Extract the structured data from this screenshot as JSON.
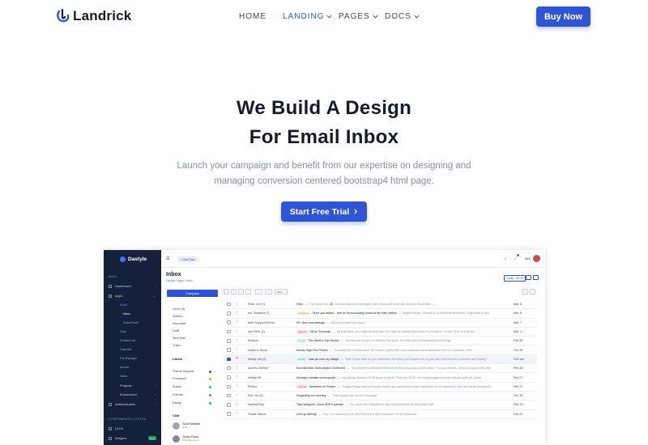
{
  "brand": {
    "name": "Landrick"
  },
  "nav": {
    "items": [
      {
        "label": "HOME",
        "active": false,
        "has_dropdown": false
      },
      {
        "label": "LANDING",
        "active": true,
        "has_dropdown": true
      },
      {
        "label": "PAGES",
        "active": false,
        "has_dropdown": true
      },
      {
        "label": "DOCS",
        "active": false,
        "has_dropdown": true
      }
    ],
    "buy_label": "Buy Now"
  },
  "hero": {
    "title_line1": "We Build A Design",
    "title_line2": "For Email Inbox",
    "subtitle_line1": "Launch your campaign and benefit from our expertise on designing and",
    "subtitle_line2": "managing conversion centered bootstrap4 html page.",
    "cta_label": "Start Free Trial"
  },
  "colors": {
    "primary": "#2f55d4",
    "heading": "#161c2d",
    "muted": "#8492a6",
    "sidebar": "#15203a"
  },
  "mockup": {
    "app_name": "Dastyle",
    "sidebar": {
      "section_main": "MAIN",
      "dashboard": "Dashboard",
      "apps": "Apps",
      "sub_items": [
        "Email",
        "Inbox",
        "Read Email",
        "Chat",
        "Contact List",
        "Calendar",
        "File Manager",
        "Invoice",
        "Tasks"
      ],
      "projects": "Projects",
      "ecommerce": "Ecommerce",
      "authentication": "Authentication",
      "section_components": "COMPONENTS & EXTRA",
      "ui_kit": "UI Kit",
      "widgets": "Widgets",
      "new_badge": "New"
    },
    "topbar": {
      "new_task": "+ New Task",
      "user_name": "Nick"
    },
    "page_title": "Inbox",
    "breadcrumb": "Dastyle / Apps / Inbox",
    "date_range": "Today : Jul 24",
    "compose": "Compose",
    "folders": [
      "Inbox (8)",
      "Starred",
      "Important",
      "Draft",
      "Sent Mail",
      "Trash"
    ],
    "labels_heading": "Labels",
    "labels": [
      {
        "name": "Theme Support",
        "color": "#2f55d4"
      },
      {
        "name": "Freelance",
        "color": "#f59e0b"
      },
      {
        "name": "Social",
        "color": "#22c55e"
      },
      {
        "name": "Friends",
        "color": "#8b5cf6"
      },
      {
        "name": "Family",
        "color": "#14b8a6"
      }
    ],
    "chat_heading": "Chat",
    "chat_users": [
      {
        "name": "Scott Median",
        "status": "Hello"
      },
      {
        "name": "Julian Rosa",
        "status": "What about our"
      }
    ],
    "toolbar_more": "More",
    "emails": [
      {
        "from": "Peter, me (3)",
        "tag": "",
        "subject": "Hello",
        "preview": "Trip home from 🎉 Colombo has been arranged, then Jenna will come get me from Stockholm. :)",
        "date": "Mar. 6",
        "starred": false,
        "selected": false
      },
      {
        "from": "me, Susanna (7)",
        "tag": "Freelance",
        "subject": "Since you asked... and I'm inconceivably bored at the train station",
        "preview": "Alright thanks. I'll have to re-book that somehow, i'll get back to you.",
        "date": "Mar. 6",
        "starred": false,
        "selected": false
      },
      {
        "from": "Web Support Dennis",
        "tag": "",
        "subject": "Re: New mail settings",
        "preview": "Will you answer him asap?",
        "date": "Mar. 7",
        "starred": false,
        "selected": false
      },
      {
        "from": "me, Peter (2)",
        "tag": "Support",
        "subject": "Off on Thursday",
        "preview": "Eff that place, you might as well stay here with us instead! Sent from my iPhone 4 > 4 mar 2014 at 5:55 pm",
        "date": "Mar. 4",
        "starred": false,
        "selected": false
      },
      {
        "from": "Medium",
        "tag": "Social",
        "subject": "This Week's Top Stories",
        "preview": "Our top pick for you on Medium this week The Man Who Destroyed America's Ego",
        "date": "Feb 28",
        "starred": false,
        "selected": false
      },
      {
        "from": "Death to Stock",
        "tag": "",
        "subject": "Montly High-Res Photos",
        "preview": "To create this month's pack, we hosted a party with local musician Jared Nickerson here in Columbus, Ohio.",
        "date": "Feb 28",
        "starred": false,
        "selected": false
      },
      {
        "from": "Randy, me (5)",
        "tag": "Family",
        "subject": "Last pic over my village",
        "preview": "Yeah i'd like that! Do you remember the video you showed me of your train ride between Colombo and Kandy?",
        "date": "5:01 am",
        "starred": true,
        "selected": true
      },
      {
        "from": "Andrew Zimmer",
        "tag": "",
        "subject": "Mochila Beta: Subscription Confirmed",
        "preview": "You've been confirmed! Welcome to the ruling class of the inbox. For your records, here is a copy of the information",
        "date": "Feb 28",
        "starred": false,
        "selected": false
      },
      {
        "from": "Infinity HR",
        "tag": "",
        "subject": "Sveriges Hetaste sommarjobb",
        "preview": "Hej Nicklas Sandell! Vi vill bjuda in dig till \"First tour 2014\", ett rekryteringsevent som erbjuder jobb på 16 bra",
        "date": "Feb 27",
        "starred": false,
        "selected": false
      },
      {
        "from": "Revibe",
        "tag": "Friends",
        "subject": "Weekend on Revibe",
        "preview": "Today's Friday and we thought maybe you want some music inspiration for the weekend. Here are some trending tracks",
        "date": "Feb 27",
        "starred": false,
        "selected": false
      },
      {
        "from": "Erik, me (5)",
        "tag": "",
        "subject": "Regarding our meeting",
        "preview": "That's great, see you on Thursday!",
        "date": "Feb 24",
        "starred": false,
        "selected": false
      },
      {
        "from": "KanbanFlow",
        "tag": "",
        "subject": "Task assigned: Clone ARP's website",
        "preview": "You have been assigned a task by Alex@Work on the board Web",
        "date": "Feb 24",
        "starred": false,
        "selected": false
      },
      {
        "from": "Tomas Kalvus",
        "tag": "",
        "subject": "Let's go fishing!",
        "preview": "Hey, You wanna join me and Fred at the lake tomorrow? It'll be awesome.",
        "date": "Feb 23",
        "starred": false,
        "selected": false
      }
    ]
  }
}
